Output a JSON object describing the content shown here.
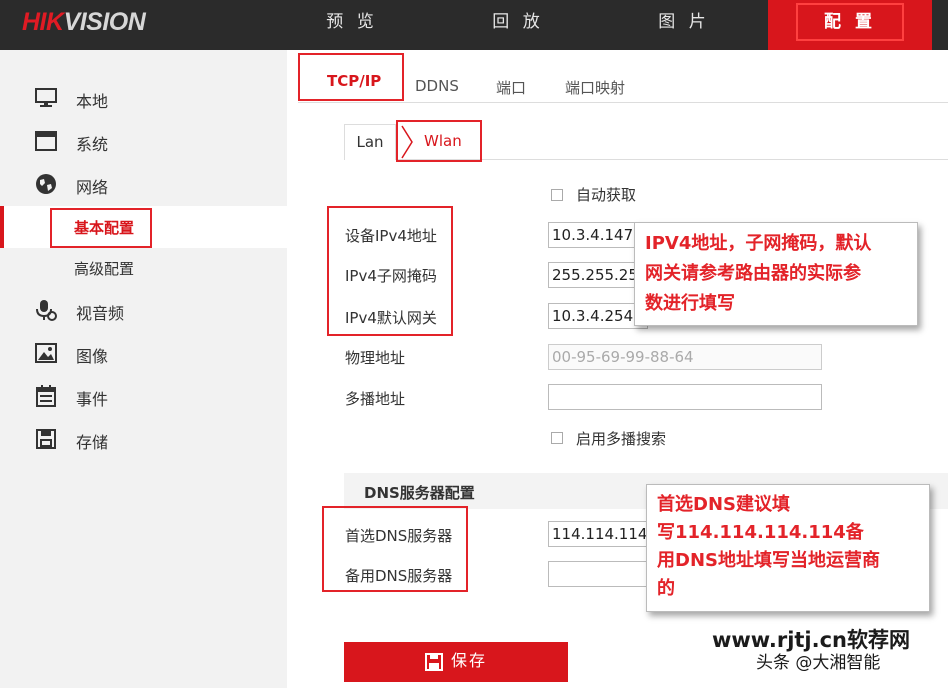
{
  "brand": {
    "hik": "HIK",
    "vision": "VISION"
  },
  "nav": [
    "预 览",
    "回 放",
    "图 片",
    "配 置"
  ],
  "sidebar": {
    "items": [
      {
        "label": "本地",
        "icon": "monitor-icon"
      },
      {
        "label": "系统",
        "icon": "window-icon"
      },
      {
        "label": "网络",
        "icon": "globe-icon"
      },
      {
        "label": "视音频",
        "icon": "microphone-icon"
      },
      {
        "label": "图像",
        "icon": "image-icon"
      },
      {
        "label": "事件",
        "icon": "calendar-icon"
      },
      {
        "label": "存储",
        "icon": "save-disk-icon"
      }
    ],
    "network_sub": [
      "基本配置",
      "高级配置"
    ]
  },
  "tabs": [
    "TCP/IP",
    "DDNS",
    "端口",
    "端口映射"
  ],
  "subtabs": [
    "Lan",
    "Wlan"
  ],
  "form": {
    "auto_label": "自动获取",
    "ipv4_addr_label": "设备IPv4地址",
    "ipv4_addr": "10.3.4.147",
    "ipv4_mask_label": "IPv4子网掩码",
    "ipv4_mask": "255.255.25",
    "ipv4_gw_label": "IPv4默认网关",
    "ipv4_gw": "10.3.4.254",
    "mac_label": "物理地址",
    "mac": "00-95-69-99-88-64",
    "multicast_label": "多播地址",
    "multicast": "",
    "multicast_search_label": "启用多播搜索"
  },
  "dns": {
    "header": "DNS服务器配置",
    "primary_label": "首选DNS服务器",
    "primary": "114.114.114",
    "secondary_label": "备用DNS服务器",
    "secondary": ""
  },
  "callouts": {
    "ipv4": [
      "IPV4地址，子网掩码，默认",
      "网关请参考路由器的实际参",
      "数进行填写"
    ],
    "dns": [
      "首选DNS建议填",
      "写114.114.114.114备",
      "用DNS地址填写当地运营商",
      "的"
    ]
  },
  "save_label": "保存",
  "watermark": {
    "line1": "www.rjtj.cn软荐网",
    "line2": "头条 @大湘智能"
  },
  "colors": {
    "accent": "#d8161c",
    "annotation": "#e32329",
    "topbar": "#2b2b2b"
  }
}
